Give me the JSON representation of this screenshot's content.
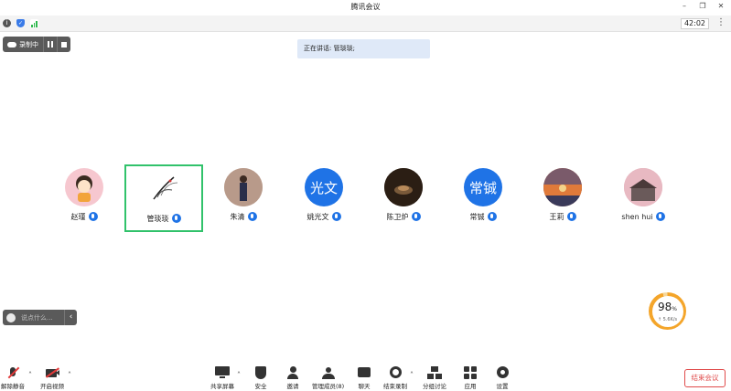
{
  "app": {
    "title": "腾讯会议"
  },
  "status": {
    "timer": "42:02"
  },
  "recording": {
    "status_label": "录制中"
  },
  "speaking": {
    "text": "正在讲话: 管琰琰;"
  },
  "participants": [
    {
      "name": "赵瑾",
      "avatar_type": "image",
      "avatar_color": "#f6c7cf"
    },
    {
      "name": "管琰琰",
      "avatar_type": "image",
      "avatar_color": "#ffffff",
      "active": true
    },
    {
      "name": "朱清",
      "avatar_type": "image",
      "avatar_color": "#c9a99a"
    },
    {
      "name": "姚光文",
      "avatar_type": "text",
      "avatar_text": "光文",
      "avatar_color": "#1f73e6"
    },
    {
      "name": "陈卫炉",
      "avatar_type": "image",
      "avatar_color": "#3b2a1d"
    },
    {
      "name": "常铖",
      "avatar_type": "text",
      "avatar_text": "常铖",
      "avatar_color": "#1f73e6"
    },
    {
      "name": "王莉",
      "avatar_type": "image",
      "avatar_color": "#c96a3a"
    },
    {
      "name": "shen hui",
      "avatar_type": "image",
      "avatar_color": "#d99aa6"
    }
  ],
  "chat": {
    "placeholder": "说点什么..."
  },
  "network": {
    "percent": "98",
    "percent_unit": "%",
    "speed": "↑ 5.6K/s"
  },
  "toolbar": {
    "unmute": "解除静音",
    "start_video": "开启视频",
    "share_screen": "共享屏幕",
    "security": "安全",
    "invite": "邀请",
    "manage_members": "管理成员(8)",
    "chat": "聊天",
    "end_recording": "结束录制",
    "breakout": "分组讨论",
    "apps": "应用",
    "settings": "设置",
    "end_meeting": "结束会议"
  },
  "colors": {
    "accent": "#1f73e6",
    "danger": "#e04b4b",
    "active_border": "#31c26b",
    "network_ring": "#f4a52a"
  }
}
